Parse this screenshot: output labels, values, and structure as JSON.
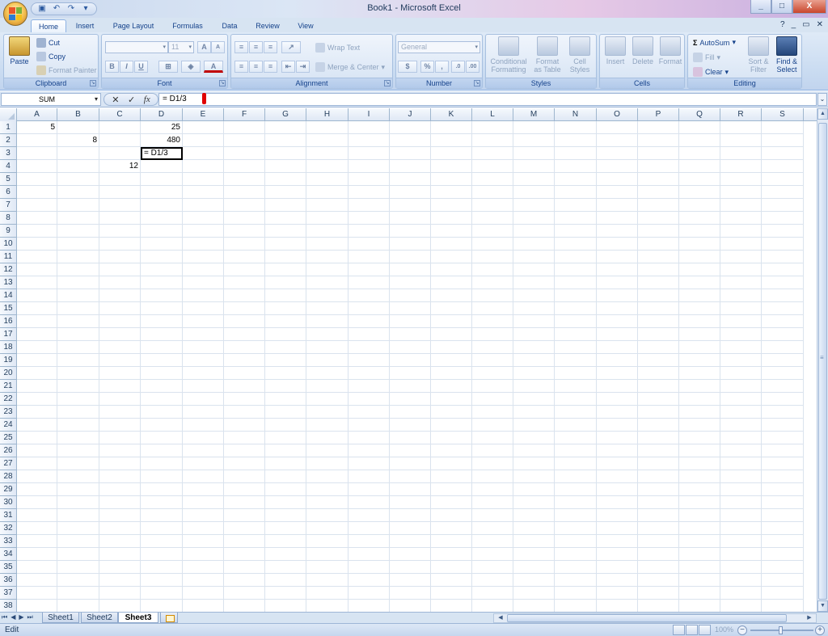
{
  "window": {
    "title": "Book1 - Microsoft Excel",
    "minimize": "_",
    "restore": "□",
    "close": "X"
  },
  "tabs": [
    {
      "label": "Home",
      "active": true
    },
    {
      "label": "Insert"
    },
    {
      "label": "Page Layout"
    },
    {
      "label": "Formulas"
    },
    {
      "label": "Data"
    },
    {
      "label": "Review"
    },
    {
      "label": "View"
    }
  ],
  "ribbon": {
    "clipboard": {
      "label": "Clipboard",
      "paste": "Paste",
      "cut": "Cut",
      "copy": "Copy",
      "format_painter": "Format Painter"
    },
    "font": {
      "label": "Font",
      "font_size": "11",
      "bold": "B",
      "italic": "I",
      "underline": "U",
      "grow": "A",
      "shrink": "A",
      "font_color": "A"
    },
    "alignment": {
      "label": "Alignment",
      "wrap_text": "Wrap Text",
      "merge_center": "Merge & Center"
    },
    "number": {
      "label": "Number",
      "format": "General",
      "currency": "$",
      "percent": "%",
      "comma": ","
    },
    "styles": {
      "label": "Styles",
      "conditional_formatting": [
        "Conditional",
        "Formatting"
      ],
      "format_as_table": [
        "Format",
        "as Table"
      ],
      "cell_styles": [
        "Cell",
        "Styles"
      ]
    },
    "cells": {
      "label": "Cells",
      "insert": "Insert",
      "delete": "Delete",
      "format": "Format"
    },
    "editing": {
      "label": "Editing",
      "autosum": "AutoSum",
      "fill": "Fill",
      "clear": "Clear",
      "sort_filter": [
        "Sort &",
        "Filter"
      ],
      "find_select": [
        "Find &",
        "Select"
      ]
    }
  },
  "formula_bar": {
    "name_box": "SUM",
    "formula": "= D1/3",
    "fx": "fx",
    "cancel": "✕",
    "enter": "✓"
  },
  "columns": [
    "A",
    "B",
    "C",
    "D",
    "E",
    "F",
    "G",
    "H",
    "I",
    "J",
    "K",
    "L",
    "M",
    "N",
    "O",
    "P",
    "Q",
    "R",
    "S"
  ],
  "row_count": 38,
  "cells": [
    {
      "ref": "A1",
      "col": 0,
      "row": 1,
      "value": "5",
      "type": "num"
    },
    {
      "ref": "D1",
      "col": 3,
      "row": 1,
      "value": "25",
      "type": "num"
    },
    {
      "ref": "B2",
      "col": 1,
      "row": 2,
      "value": "8",
      "type": "num"
    },
    {
      "ref": "D2",
      "col": 3,
      "row": 2,
      "value": "480",
      "type": "num"
    },
    {
      "ref": "D3",
      "col": 3,
      "row": 3,
      "value": "= D1/3",
      "type": "text",
      "editing": true
    },
    {
      "ref": "C4",
      "col": 2,
      "row": 4,
      "value": "12",
      "type": "num"
    }
  ],
  "sheets": [
    {
      "label": "Sheet1"
    },
    {
      "label": "Sheet2"
    },
    {
      "label": "Sheet3",
      "active": true
    }
  ],
  "status": {
    "mode": "Edit",
    "zoom": "100%"
  }
}
